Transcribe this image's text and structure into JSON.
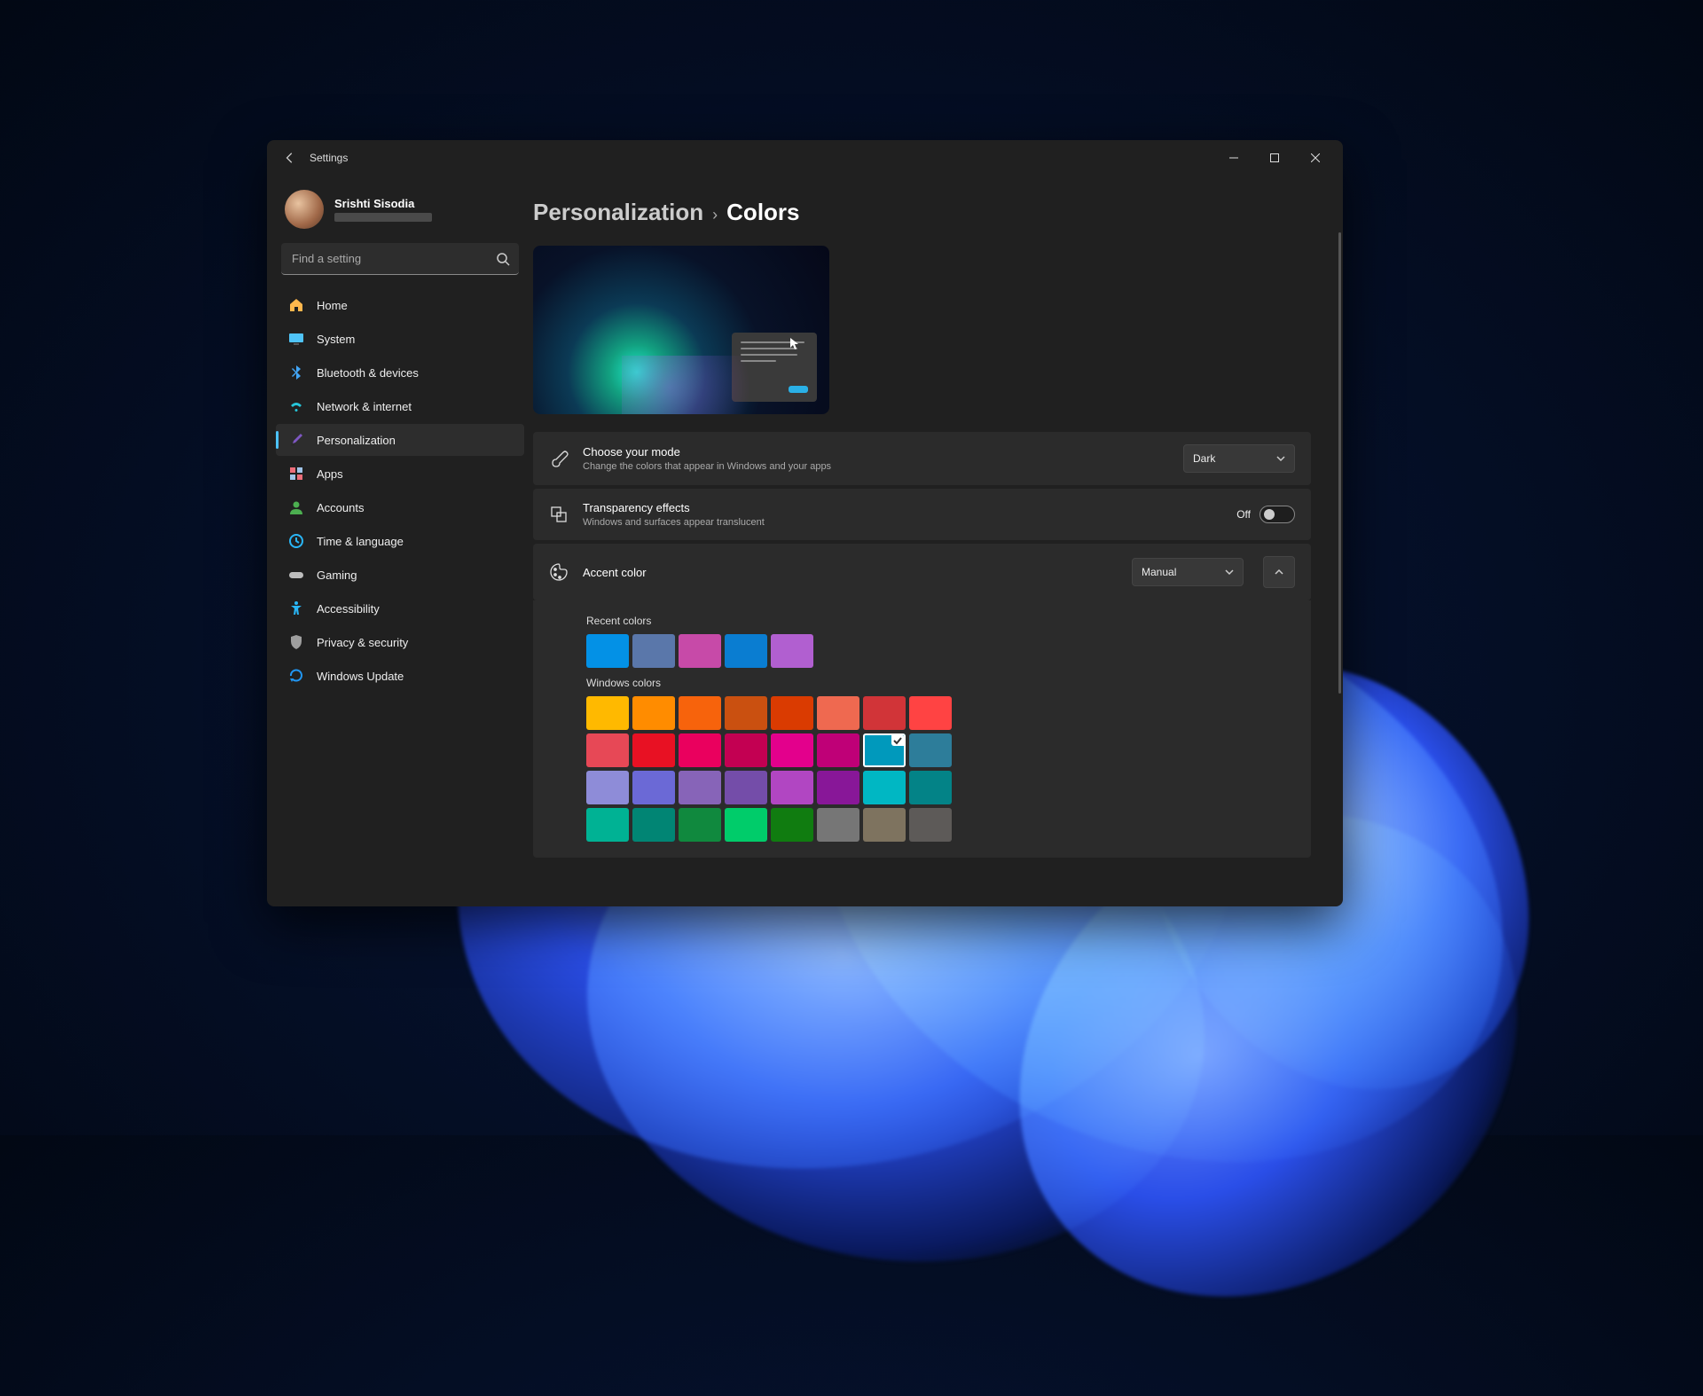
{
  "window": {
    "title": "Settings"
  },
  "user": {
    "name": "Srishti Sisodia"
  },
  "search": {
    "placeholder": "Find a setting"
  },
  "nav": {
    "items": [
      {
        "label": "Home",
        "icon": "home",
        "color": "#ffb74d"
      },
      {
        "label": "System",
        "icon": "system",
        "color": "#4fc3f7"
      },
      {
        "label": "Bluetooth & devices",
        "icon": "bluetooth",
        "color": "#42a5f5"
      },
      {
        "label": "Network & internet",
        "icon": "wifi",
        "color": "#26c6da"
      },
      {
        "label": "Personalization",
        "icon": "brush",
        "color": "#7e57c2",
        "active": true
      },
      {
        "label": "Apps",
        "icon": "apps",
        "color": "#ec6e7a"
      },
      {
        "label": "Accounts",
        "icon": "person",
        "color": "#4caf50"
      },
      {
        "label": "Time & language",
        "icon": "clock",
        "color": "#29b6f6"
      },
      {
        "label": "Gaming",
        "icon": "gamepad",
        "color": "#bdbdbd"
      },
      {
        "label": "Accessibility",
        "icon": "accessibility",
        "color": "#29b6f6"
      },
      {
        "label": "Privacy & security",
        "icon": "shield",
        "color": "#9e9e9e"
      },
      {
        "label": "Windows Update",
        "icon": "update",
        "color": "#2196f3"
      }
    ]
  },
  "breadcrumb": {
    "parent": "Personalization",
    "sep": "›",
    "current": "Colors"
  },
  "mode": {
    "title": "Choose your mode",
    "sub": "Change the colors that appear in Windows and your apps",
    "value": "Dark"
  },
  "transparency": {
    "title": "Transparency effects",
    "sub": "Windows and surfaces appear translucent",
    "state_label": "Off"
  },
  "accent": {
    "title": "Accent color",
    "value": "Manual",
    "recent_label": "Recent colors",
    "recent": [
      "#0391e6",
      "#5a77aa",
      "#c74aa8",
      "#0a7dd1",
      "#b15fd0"
    ],
    "windows_label": "Windows colors",
    "windows": [
      "#ffb900",
      "#ff8c00",
      "#f7630c",
      "#ca5010",
      "#da3b01",
      "#ef6950",
      "#d13438",
      "#ff4343",
      "#e74856",
      "#e81123",
      "#ea005e",
      "#c30052",
      "#e3008c",
      "#bf0077",
      "#0099bc",
      "#2d7d9a",
      "#8e8cd8",
      "#6b69d6",
      "#8764b8",
      "#744da9",
      "#b146c2",
      "#881798",
      "#00b7c3",
      "#038387",
      "#00b294",
      "#018574",
      "#10893e",
      "#00cc6a",
      "#107c10",
      "#767676",
      "#7e735f",
      "#5d5a58"
    ],
    "selected_index": 14
  }
}
